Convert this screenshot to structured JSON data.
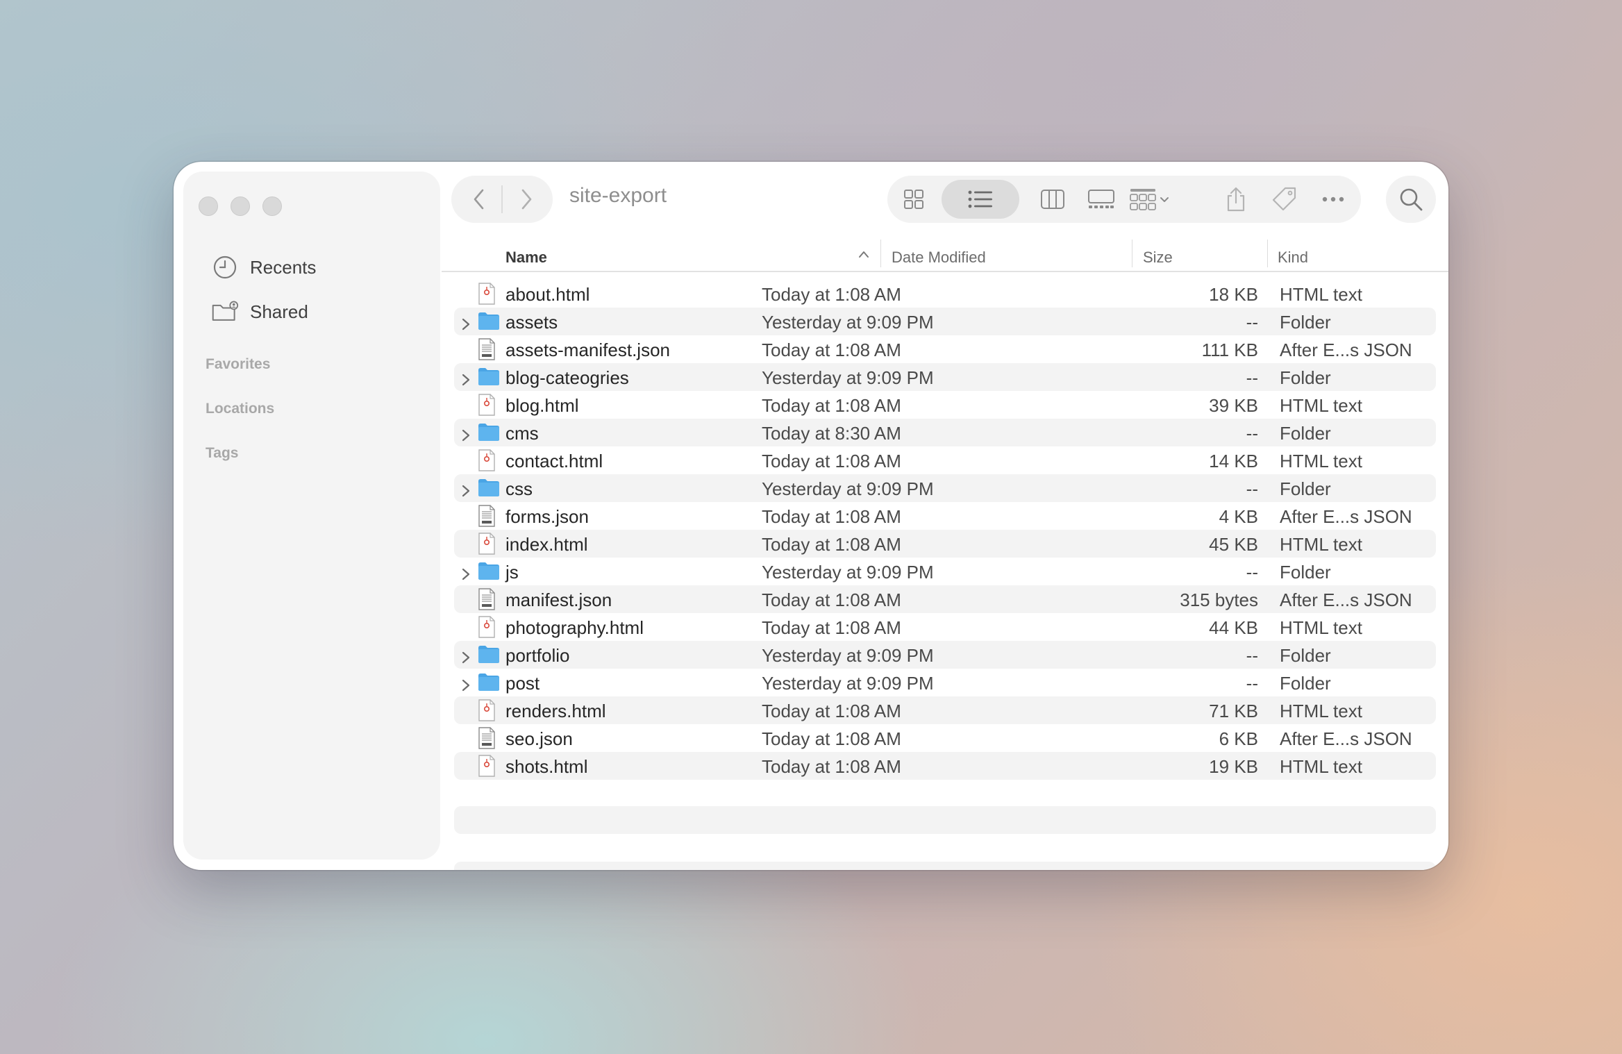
{
  "window": {
    "title": "site-export"
  },
  "sidebar": {
    "items": [
      {
        "label": "Recents",
        "icon": "clock-icon"
      },
      {
        "label": "Shared",
        "icon": "shared-folder-icon"
      }
    ],
    "sections": [
      {
        "label": "Favorites"
      },
      {
        "label": "Locations"
      },
      {
        "label": "Tags"
      }
    ]
  },
  "toolbar": {
    "view_modes": [
      "icon-view",
      "list-view",
      "column-view",
      "gallery-view"
    ],
    "active_view": "list-view",
    "group_icon": "group-icon",
    "actions": [
      "share-icon",
      "tag-icon",
      "more-icon"
    ],
    "search_icon": "search-icon"
  },
  "columns": {
    "name": "Name",
    "date": "Date Modified",
    "size": "Size",
    "kind": "Kind"
  },
  "files": [
    {
      "name": "about.html",
      "date": "Today at 1:08 AM",
      "size": "18 KB",
      "kind": "HTML text",
      "type": "html"
    },
    {
      "name": "assets",
      "date": "Yesterday at 9:09 PM",
      "size": "--",
      "kind": "Folder",
      "type": "folder"
    },
    {
      "name": "assets-manifest.json",
      "date": "Today at 1:08 AM",
      "size": "111 KB",
      "kind": "After E...s JSON",
      "type": "json"
    },
    {
      "name": "blog-cateogries",
      "date": "Yesterday at 9:09 PM",
      "size": "--",
      "kind": "Folder",
      "type": "folder"
    },
    {
      "name": "blog.html",
      "date": "Today at 1:08 AM",
      "size": "39 KB",
      "kind": "HTML text",
      "type": "html"
    },
    {
      "name": "cms",
      "date": "Today at 8:30 AM",
      "size": "--",
      "kind": "Folder",
      "type": "folder"
    },
    {
      "name": "contact.html",
      "date": "Today at 1:08 AM",
      "size": "14 KB",
      "kind": "HTML text",
      "type": "html"
    },
    {
      "name": "css",
      "date": "Yesterday at 9:09 PM",
      "size": "--",
      "kind": "Folder",
      "type": "folder"
    },
    {
      "name": "forms.json",
      "date": "Today at 1:08 AM",
      "size": "4 KB",
      "kind": "After E...s JSON",
      "type": "json"
    },
    {
      "name": "index.html",
      "date": "Today at 1:08 AM",
      "size": "45 KB",
      "kind": "HTML text",
      "type": "html"
    },
    {
      "name": "js",
      "date": "Yesterday at 9:09 PM",
      "size": "--",
      "kind": "Folder",
      "type": "folder"
    },
    {
      "name": "manifest.json",
      "date": "Today at 1:08 AM",
      "size": "315 bytes",
      "kind": "After E...s JSON",
      "type": "json"
    },
    {
      "name": "photography.html",
      "date": "Today at 1:08 AM",
      "size": "44 KB",
      "kind": "HTML text",
      "type": "html"
    },
    {
      "name": "portfolio",
      "date": "Yesterday at 9:09 PM",
      "size": "--",
      "kind": "Folder",
      "type": "folder"
    },
    {
      "name": "post",
      "date": "Yesterday at 9:09 PM",
      "size": "--",
      "kind": "Folder",
      "type": "folder"
    },
    {
      "name": "renders.html",
      "date": "Today at 1:08 AM",
      "size": "71 KB",
      "kind": "HTML text",
      "type": "html"
    },
    {
      "name": "seo.json",
      "date": "Today at 1:08 AM",
      "size": "6 KB",
      "kind": "After E...s JSON",
      "type": "json"
    },
    {
      "name": "shots.html",
      "date": "Today at 1:08 AM",
      "size": "19 KB",
      "kind": "HTML text",
      "type": "html"
    }
  ],
  "colors": {
    "folder": "#5eb4ee",
    "folder_tab": "#4aa5e5",
    "html_mark": "#d9493b"
  }
}
